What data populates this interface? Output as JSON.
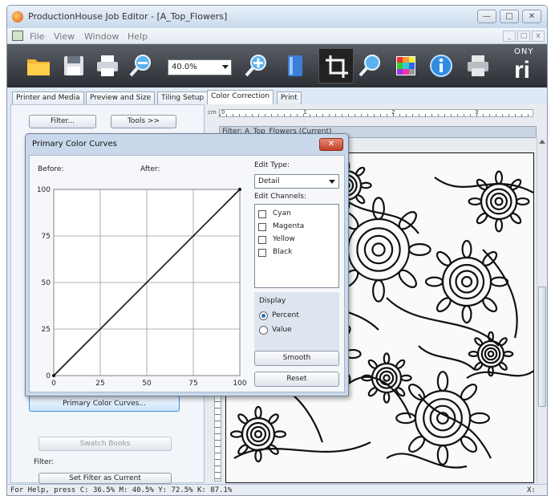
{
  "window": {
    "title": "ProductionHouse Job Editor - [A_Top_Flowers]",
    "buttons": {
      "minimize": "—",
      "maximize": "□",
      "close": "✕"
    }
  },
  "menu": {
    "items": [
      "File",
      "View",
      "Window",
      "Help"
    ],
    "mdi_buttons": [
      "_",
      "□",
      "x"
    ]
  },
  "toolbar": {
    "zoom_value": "40.0%",
    "brand_top": "ONY",
    "brand_bottom": "ri"
  },
  "tabs": [
    {
      "label": "Printer and Media",
      "active": false
    },
    {
      "label": "Preview and Size",
      "active": false
    },
    {
      "label": "Tiling Setup",
      "active": false
    },
    {
      "label": "Color Correction",
      "active": true
    },
    {
      "label": "Print",
      "active": false
    }
  ],
  "left_panel": {
    "filter_button": "Filter...",
    "tools_button": "Tools >>",
    "primary_curves_button": "Primary Color Curves...",
    "swatch_books_button": "Swatch Books",
    "filter_label": "Filter:",
    "set_filter_button": "Set Filter as Current"
  },
  "canvas": {
    "ruler_unit": "cm",
    "ruler_numbers": [
      "0",
      "1",
      "2",
      "3"
    ],
    "filter_label": "Filter: A_Top_Flowers (Current)"
  },
  "dialog": {
    "title": "Primary Color Curves",
    "close": "✕",
    "before_label": "Before:",
    "after_label": "After:",
    "edit_type_label": "Edit Type:",
    "edit_type_value": "Detail",
    "edit_channels_label": "Edit Channels:",
    "channels": [
      "Cyan",
      "Magenta",
      "Yellow",
      "Black"
    ],
    "display_label": "Display",
    "display_options": [
      {
        "label": "Percent",
        "selected": true
      },
      {
        "label": "Value",
        "selected": false
      }
    ],
    "smooth_button": "Smooth",
    "reset_button": "Reset"
  },
  "chart_data": {
    "type": "line",
    "title": "",
    "xlabel": "",
    "ylabel": "",
    "xlim": [
      0,
      100
    ],
    "ylim": [
      0,
      100
    ],
    "x_ticks": [
      "0",
      "25",
      "50",
      "75",
      "100"
    ],
    "y_ticks": [
      "0",
      "25",
      "50",
      "75",
      "100"
    ],
    "grid": true,
    "series": [
      {
        "x": [
          0,
          100
        ],
        "y": [
          0,
          100
        ]
      }
    ]
  },
  "status": {
    "text": "For Help, press C: 36.5% M: 40.5% Y: 72.5% K: 87.1%",
    "right": "X:"
  },
  "colors": {
    "toolbar_bg": "#2b2f34",
    "dialog_bg": "#c9d8ea",
    "close_red": "#c3412c",
    "highlight_blue": "#3b8fd6"
  }
}
